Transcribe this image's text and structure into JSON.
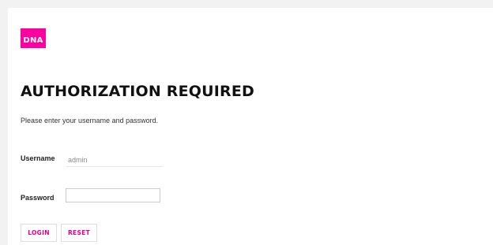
{
  "logo": {
    "text": "DNA",
    "color": "#ff00a0"
  },
  "auth": {
    "title": "AUTHORIZATION REQUIRED",
    "subtitle": "Please enter your username and password."
  },
  "form": {
    "username_label": "Username",
    "username_value": "admin",
    "password_label": "Password",
    "password_value": ""
  },
  "buttons": {
    "login_label": "LOGIN",
    "reset_label": "RESET",
    "accent": "#e0008c"
  }
}
